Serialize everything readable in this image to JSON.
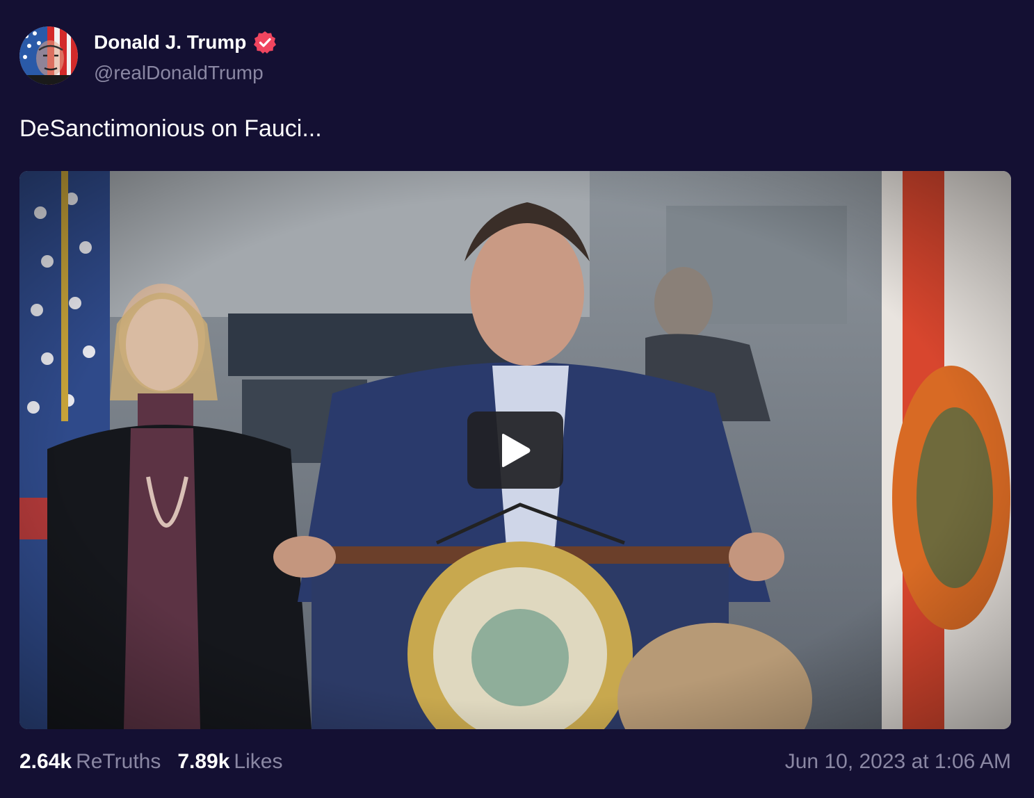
{
  "author": {
    "name": "Donald J. Trump",
    "handle": "@realDonaldTrump",
    "verified": true,
    "verified_icon": "verified-badge-icon"
  },
  "post": {
    "text": "DeSanctimonious on Fauci..."
  },
  "media": {
    "type": "video",
    "play_icon": "play-icon"
  },
  "stats": {
    "retruths_count": "2.64k",
    "retruths_label": "ReTruths",
    "likes_count": "7.89k",
    "likes_label": "Likes"
  },
  "timestamp": "Jun 10, 2023 at 1:06 AM",
  "colors": {
    "background": "#141033",
    "muted_text": "#8a87a3",
    "verified_badge": "#f0455f"
  }
}
